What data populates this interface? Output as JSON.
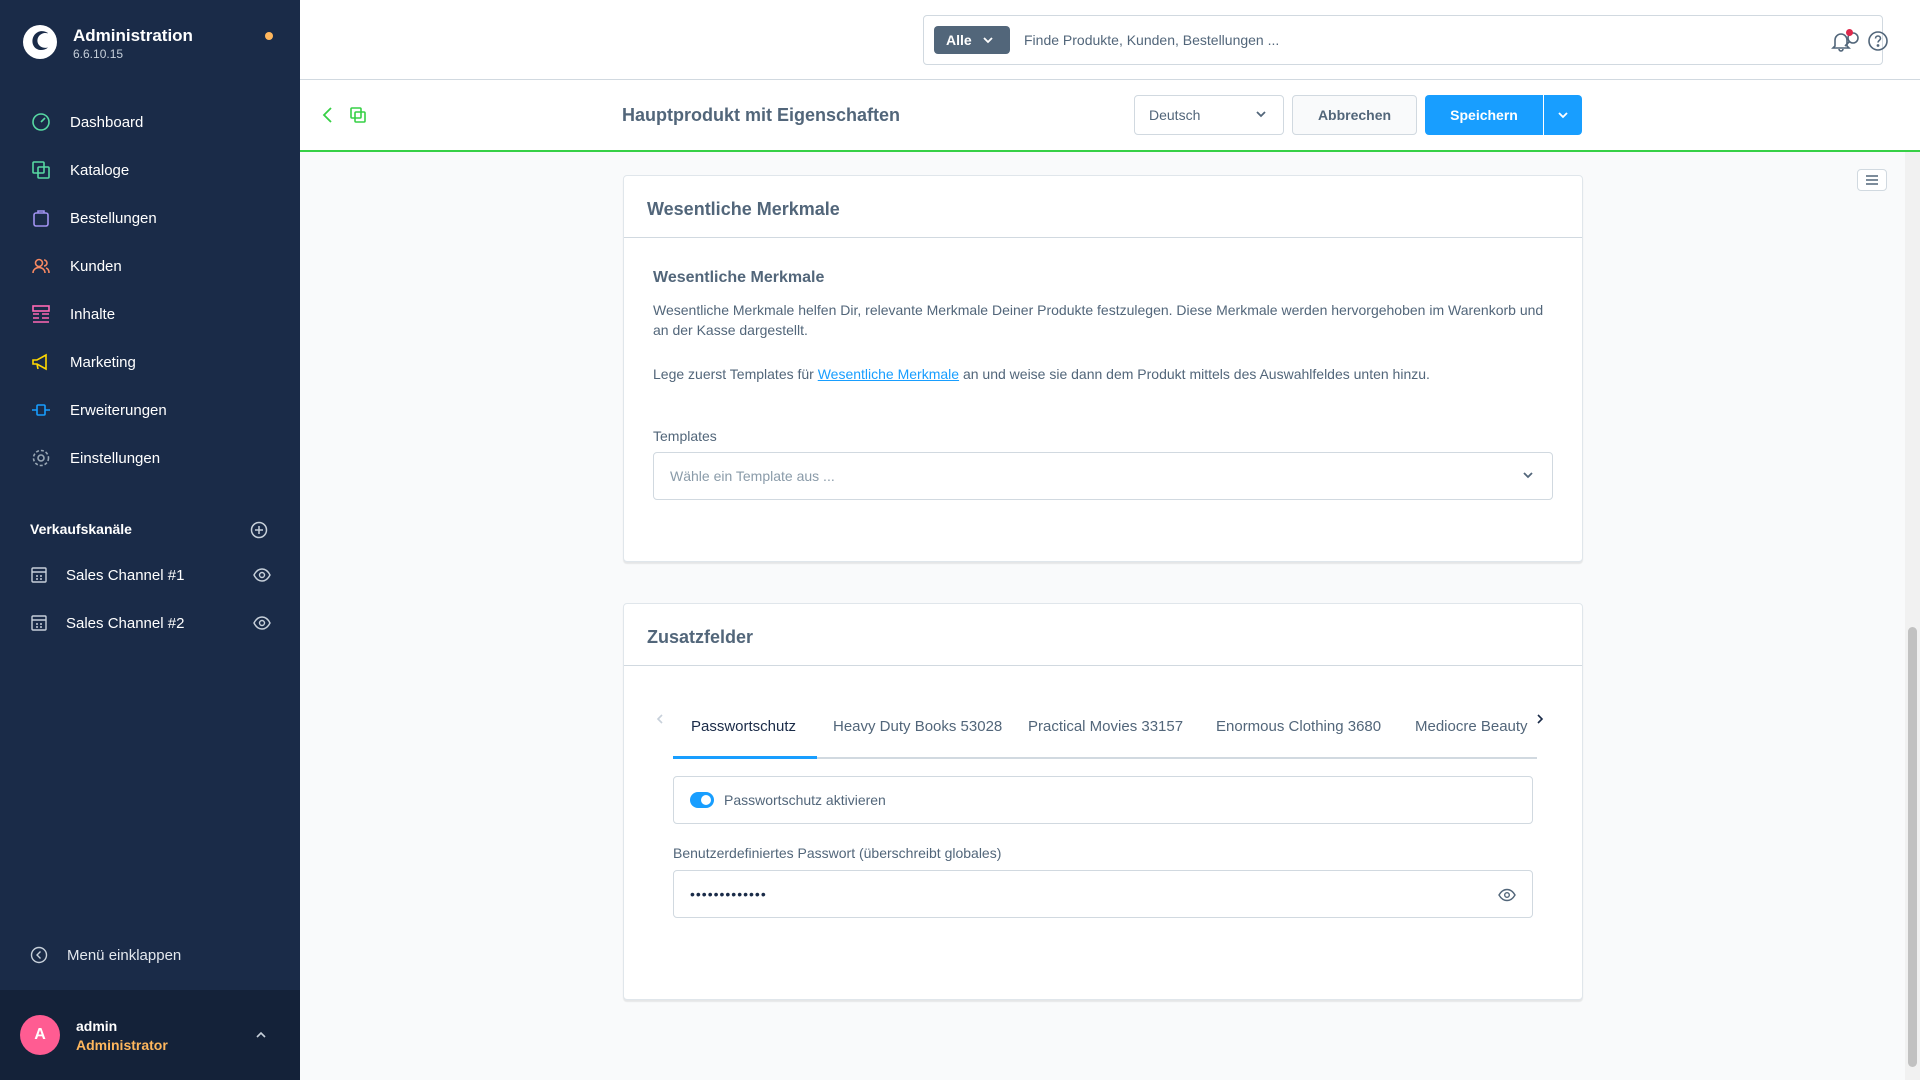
{
  "brand": {
    "title": "Administration",
    "version": "6.6.10.15"
  },
  "nav": [
    {
      "label": "Dashboard",
      "icon": "dashboard-icon",
      "color": "#57d9a3"
    },
    {
      "label": "Kataloge",
      "icon": "catalog-icon",
      "color": "#57d9a3"
    },
    {
      "label": "Bestellungen",
      "icon": "orders-icon",
      "color": "#a092f0"
    },
    {
      "label": "Kunden",
      "icon": "customers-icon",
      "color": "#f88962"
    },
    {
      "label": "Inhalte",
      "icon": "content-icon",
      "color": "#ff68b4"
    },
    {
      "label": "Marketing",
      "icon": "marketing-icon",
      "color": "#ffd700"
    },
    {
      "label": "Erweiterungen",
      "icon": "extensions-icon",
      "color": "#189eff"
    },
    {
      "label": "Einstellungen",
      "icon": "settings-icon",
      "color": "#9aa8b5"
    }
  ],
  "sales_channels": {
    "title": "Verkaufskanäle",
    "items": [
      {
        "label": "Sales Channel #1"
      },
      {
        "label": "Sales Channel #2"
      }
    ]
  },
  "collapse_label": "Menü einklappen",
  "user": {
    "initial": "A",
    "name": "admin",
    "role": "Administrator"
  },
  "search": {
    "type": "Alle",
    "placeholder": "Finde Produkte, Kunden, Bestellungen ..."
  },
  "header": {
    "title": "Hauptprodukt mit Eigenschaften",
    "language": "Deutsch",
    "cancel": "Abbrechen",
    "save": "Speichern"
  },
  "essentials": {
    "card_title": "Wesentliche Merkmale",
    "heading": "Wesentliche Merkmale",
    "text1": "Wesentliche Merkmale helfen Dir, relevante Merkmale Deiner Produkte festzulegen. Diese Merkmale werden hervorgehoben im Warenkorb und an der Kasse dargestellt.",
    "text2_pre": "Lege zuerst Templates für ",
    "text2_link": "Wesentliche Merkmale",
    "text2_post": " an und weise sie dann dem Produkt mittels des Auswahlfeldes unten hinzu.",
    "templates_label": "Templates",
    "templates_placeholder": "Wähle ein Template aus ..."
  },
  "custom_fields": {
    "card_title": "Zusatzfelder",
    "tabs": [
      "Passwortschutz",
      "Heavy Duty Books 53028",
      "Practical Movies 33157",
      "Enormous Clothing 3680",
      "Mediocre Beauty"
    ],
    "active_tab": 0,
    "toggle_label": "Passwortschutz aktivieren",
    "toggle_on": true,
    "password_label": "Benutzerdefiniertes Passwort (überschreibt globales)",
    "password_mask": "•••••••••••••"
  },
  "colors": {
    "sidebar": "#1a2b48",
    "accent": "#189eff",
    "highlight": "#ffb75d",
    "header_border": "#37d046"
  }
}
